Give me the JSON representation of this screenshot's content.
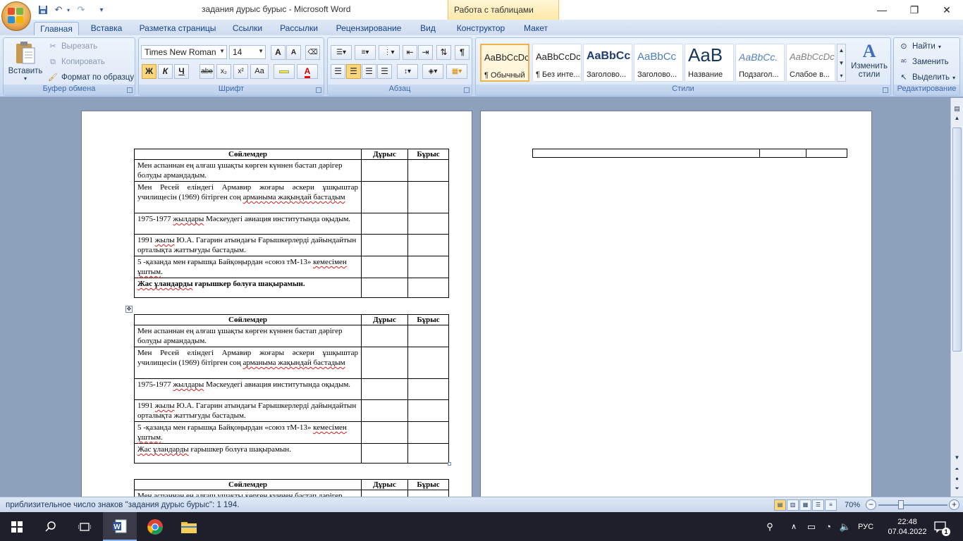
{
  "window": {
    "title": "задания дурыс бурыс - Microsoft Word",
    "context_tab": "Работа с таблицами",
    "controls": {
      "minimize": "—",
      "restore": "❐",
      "close": "✕"
    }
  },
  "quick_access": {
    "undo": "↶",
    "redo": "↷",
    "customize": "▾"
  },
  "tabs": [
    {
      "label": "Главная"
    },
    {
      "label": "Вставка"
    },
    {
      "label": "Разметка страницы"
    },
    {
      "label": "Ссылки"
    },
    {
      "label": "Рассылки"
    },
    {
      "label": "Рецензирование"
    },
    {
      "label": "Вид"
    },
    {
      "label": "Конструктор"
    },
    {
      "label": "Макет"
    }
  ],
  "ribbon": {
    "clipboard": {
      "label": "Буфер обмена",
      "paste": "Вставить",
      "cut": "Вырезать",
      "copy": "Копировать",
      "format_painter": "Формат по образцу"
    },
    "font": {
      "label": "Шрифт",
      "font_name": "Times New Roman",
      "font_size": "14",
      "grow": "A",
      "shrink": "A",
      "bold": "Ж",
      "italic": "К",
      "underline": "Ч",
      "strike": "abe",
      "subscript": "x₂",
      "superscript": "x²",
      "case": "Aa",
      "highlight_color": "#ffff00",
      "font_color": "#ff0000"
    },
    "paragraph": {
      "label": "Абзац",
      "pilcrow": "¶"
    },
    "styles": {
      "label": "Стили",
      "items": [
        {
          "sample": "AaBbCcDc",
          "name": "¶ Обычный"
        },
        {
          "sample": "AaBbCcDc",
          "name": "¶ Без инте..."
        },
        {
          "sample": "AaBbCc",
          "name": "Заголово..."
        },
        {
          "sample": "AaBbCc",
          "name": "Заголово..."
        },
        {
          "sample": "AaB",
          "name": "Название"
        },
        {
          "sample": "AaBbCc.",
          "name": "Подзагол..."
        },
        {
          "sample": "AaBbCcDc",
          "name": "Слабое в..."
        }
      ],
      "change_styles": "Изменить стили"
    },
    "editing": {
      "label": "Редактирование",
      "find": "Найти",
      "replace": "Заменить",
      "select": "Выделить"
    }
  },
  "document": {
    "header": {
      "col1": "Сөйлемдер",
      "col2": "Дұрыс",
      "col3": "Бұрыс"
    },
    "rows": [
      {
        "pre": "Мен аспаннан ең алғаш ұшақты көрген күннен бастап дәрігер болуды армандадым.",
        "sp": "",
        "post": ""
      },
      {
        "pre": "Мен Ресей еліндегі Армавир жоғары әскери ұшқыштар училищесін (1969) бітірген соң ",
        "sp": "арманыма жақындай бастадым",
        "post": ""
      },
      {
        "pre": "1975-1977 ",
        "sp": "жылдары",
        "post": " Мәскеудегі авиация институтында оқыдым."
      },
      {
        "pre": "1991 ",
        "sp": "жылы",
        "post": " Ю.А. Гагарин атындағы Ғарышкерлерді дайындайтын орталықта жаттығуды бастадым."
      },
      {
        "pre": "5 -қазанда мен ғарышқа Байқоңырдан «союз тМ-13» ",
        "sp": "кемесімен ұштым",
        "post": "."
      },
      {
        "pre": "",
        "sp": "Жас ұландарды",
        "post": " ғарышкер болуға шақырамын."
      }
    ]
  },
  "statusbar": {
    "message": "приблизительное число знаков \"задания дурыс бурыс\": 1 194.",
    "zoom": "70%"
  },
  "taskbar": {
    "language": "РУС",
    "time": "22:48",
    "date": "07.04.2022",
    "notification_count": "1"
  }
}
